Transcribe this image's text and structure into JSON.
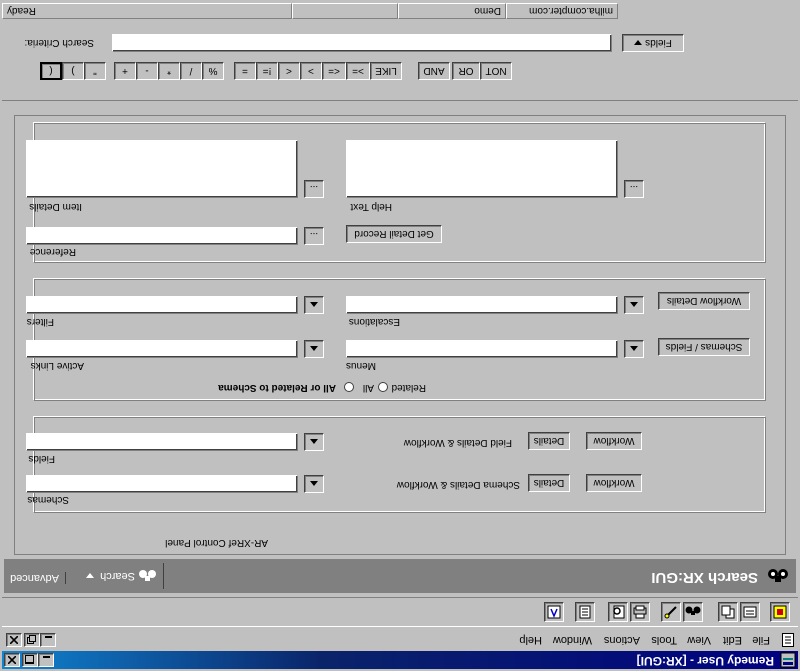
{
  "window": {
    "title": "Remedy User - [XR:GUI]",
    "app_icon": "remedy-app-icon"
  },
  "menu": [
    "File",
    "Edit",
    "View",
    "Tools",
    "Actions",
    "Window",
    "Help"
  ],
  "toolbar_icons": [
    "new-request-icon",
    "open-icon",
    "copy-icon",
    "search-binoculars-icon",
    "clear-icon",
    "print-icon",
    "preview-icon",
    "report-icon",
    "workflow-icon"
  ],
  "search_bar": {
    "title": "Search XR:GUI",
    "search_label": "Search",
    "advanced_label": "Advanced"
  },
  "form": {
    "control_panel_label": "AR-XRef Control Panel",
    "schemas": {
      "label": "Schemas",
      "details_label": "Schema Details & Workflow",
      "details_btn": "Details",
      "workflow_btn": "Workflow"
    },
    "fields": {
      "label": "Fields",
      "details_label": "Field Details & Workflow",
      "details_btn": "Details",
      "workflow_btn": "Workflow"
    },
    "schema_filter": {
      "label": "All or Related to Schema",
      "all": "All",
      "related": "Related"
    },
    "active_links": {
      "label": "Active Links"
    },
    "menus": {
      "label": "Menus",
      "btn": "Schemas / Fields"
    },
    "filters": {
      "label": "Filters"
    },
    "escalations": {
      "label": "Escalations",
      "btn": "Workflow Details"
    },
    "reference": {
      "label": "Reference",
      "ellipsis": "...",
      "btn": "Get Detail Record"
    },
    "item_details": {
      "label": "Item Details",
      "ellipsis": "..."
    },
    "help_text": {
      "label": "Help Text",
      "ellipsis": "..."
    }
  },
  "operators": [
    "(",
    ")",
    "\"",
    "+",
    "-",
    "*",
    "/",
    "%",
    "=",
    "!=",
    "<",
    ">",
    "<=",
    ">=",
    "LIKE",
    "AND",
    "OR",
    "NOT"
  ],
  "search_criteria": {
    "label": "Search Criteria:",
    "value": "",
    "fields_btn": "Fields"
  },
  "status_bar": {
    "ready": "Ready",
    "mode": "Demo",
    "server": "milha.compter.com"
  }
}
